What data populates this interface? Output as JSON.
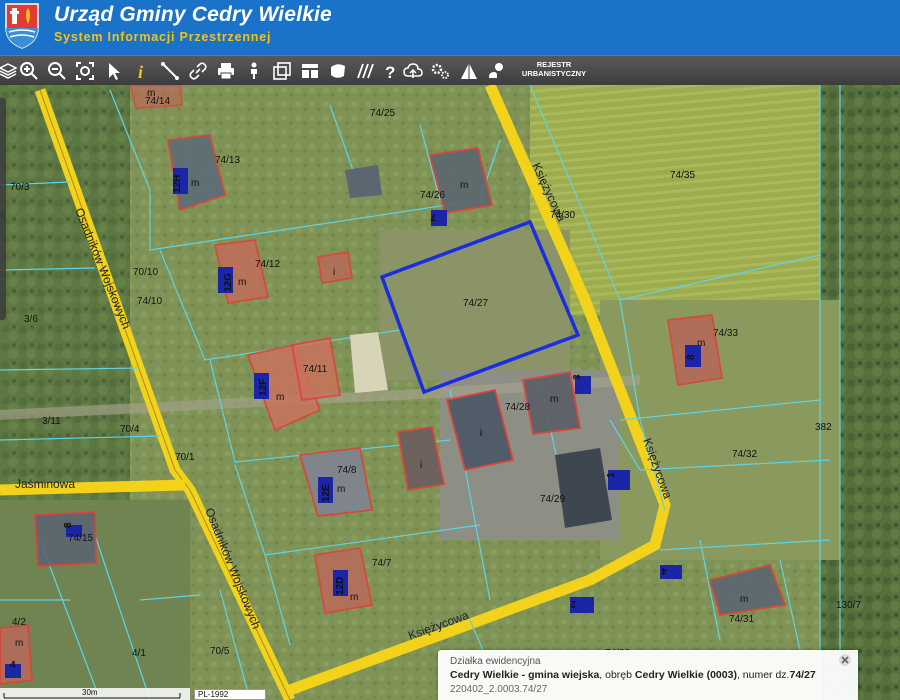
{
  "header": {
    "title": "Urząd Gminy Cedry Wielkie",
    "subtitle": "System Informacji Przestrzennej"
  },
  "toolbar": {
    "tools": [
      {
        "name": "layers-icon"
      },
      {
        "name": "zoom-in-icon"
      },
      {
        "name": "zoom-out-icon"
      },
      {
        "name": "zoom-extent-icon"
      },
      {
        "name": "pointer-icon"
      },
      {
        "name": "info-icon"
      },
      {
        "name": "measure-icon"
      },
      {
        "name": "link-icon"
      },
      {
        "name": "print-icon"
      },
      {
        "name": "street-view-icon"
      },
      {
        "name": "export-icon"
      },
      {
        "name": "layout-icon"
      },
      {
        "name": "draw-shape-icon"
      },
      {
        "name": "hatch-icon"
      },
      {
        "name": "help-icon"
      },
      {
        "name": "cloud-upload-icon"
      },
      {
        "name": "settings-icon"
      },
      {
        "name": "prism-icon"
      },
      {
        "name": "user-location-icon"
      }
    ],
    "rejestr_label_1": "REJESTR",
    "rejestr_label_2": "URBANISTYCZNY"
  },
  "map": {
    "roads": [
      "Osadników Wojskowych",
      "Osadników Wojskowych",
      "Księżycowa",
      "Księżycowa",
      "Księżycowa",
      "Jaśminowa"
    ],
    "parcels": [
      "74/14",
      "74/25",
      "74/13",
      "74/26",
      "70/3",
      "74/35",
      "74/30",
      "74/12",
      "70/10",
      "74/10",
      "74/27",
      "3/6",
      "74/33",
      "74/11",
      "74/28",
      "3/11",
      "70/4",
      "382",
      "74/32",
      "70/1",
      "74/8",
      "74/29",
      "74/15",
      "74/7",
      "4/2",
      "4/1",
      "70/5",
      "74/31",
      "130/7",
      "6",
      "74/30"
    ],
    "building_labels": [
      "m",
      "m",
      "12H",
      "m",
      "i",
      "12G",
      "m",
      "12F",
      "m",
      "i",
      "12E",
      "m",
      "i",
      "m",
      "i",
      "12D",
      "m",
      "m",
      "8",
      "m",
      "m"
    ],
    "address_numbers": [
      "7",
      "3",
      "1",
      "4",
      "2",
      "8",
      "4"
    ],
    "selected_parcel": "74/27"
  },
  "popup": {
    "title": "Działka ewidencyjna",
    "line_pre": "Cedry Wielkie - gmina wiejska",
    "line_mid1": ", obręb ",
    "line_bold2": "Cedry Wielkie (0003)",
    "line_mid2": ", numer dz.",
    "line_bold3": "74/27",
    "id": "220402_2.0003.74/27"
  },
  "scale": {
    "label": "30m",
    "crs": "PL-1992"
  },
  "colors": {
    "header_bg": "#1b72c9",
    "subtitle": "#f3c21a",
    "road": "#f2d21b",
    "parcel_line": "#5ed4e6",
    "building_outline": "#e0403a",
    "selected_outline": "#1a2ee0"
  }
}
